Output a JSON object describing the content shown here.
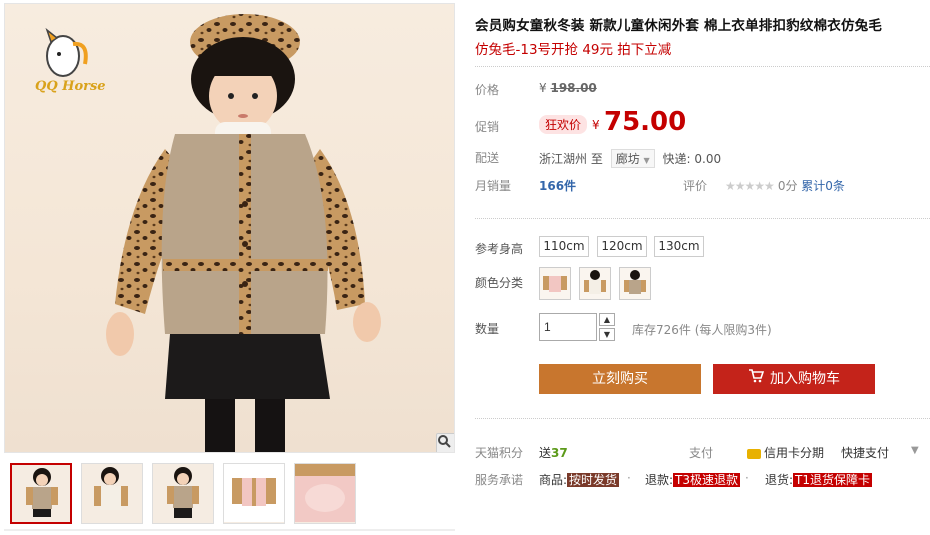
{
  "gallery": {
    "logo_text": "QQ Horse",
    "thumbnails": [
      "thumb-1",
      "thumb-2",
      "thumb-3",
      "thumb-4",
      "thumb-5"
    ],
    "active_index": 0
  },
  "product": {
    "title": "会员购女童秋冬装 新款儿童休闲外套 棉上衣单排扣豹纹棉衣仿兔毛",
    "subtitle": "仿兔毛-13号开抢 49元 拍下立减"
  },
  "price": {
    "label": "价格",
    "currency": "¥",
    "original": "198.00",
    "promo_label": "促销",
    "promo_tag": "狂欢价",
    "promo_price": "75.00"
  },
  "delivery": {
    "label": "配送",
    "from": "浙江湖州",
    "to_word": "至",
    "destination": "廊坊",
    "express": "快递: 0.00"
  },
  "sales": {
    "label": "月销量",
    "count": "166件",
    "rating_label": "评价",
    "stars": "★★★★★",
    "score": "0分",
    "reviews": "累计0条"
  },
  "options": {
    "size_label": "参考身高",
    "sizes": [
      "110cm",
      "120cm",
      "130cm"
    ],
    "color_label": "颜色分类",
    "qty_label": "数量",
    "qty_value": "1",
    "qty_up": "▲",
    "qty_down": "▼",
    "stock": "库存726件  (每人限购3件)"
  },
  "actions": {
    "buy_now": "立刻购买",
    "add_to_cart": "加入购物车"
  },
  "service": {
    "points_label": "天猫积分",
    "points_prefix": "送",
    "points_value": "37",
    "pay_label": "支付",
    "credit_card": "信用卡分期",
    "quick_pay": "快捷支付",
    "promise_label": "服务承诺",
    "goods_prefix": "商品:",
    "goods_tag": "按时发货",
    "refund_prefix": "退款:",
    "refund_tag": "T3极速退款",
    "return_prefix": "退货:",
    "return_tag": "T1退货保障卡"
  },
  "colors": {
    "accent_red": "#c40000",
    "buy_orange": "#c8762e",
    "cart_red": "#c4231a"
  }
}
